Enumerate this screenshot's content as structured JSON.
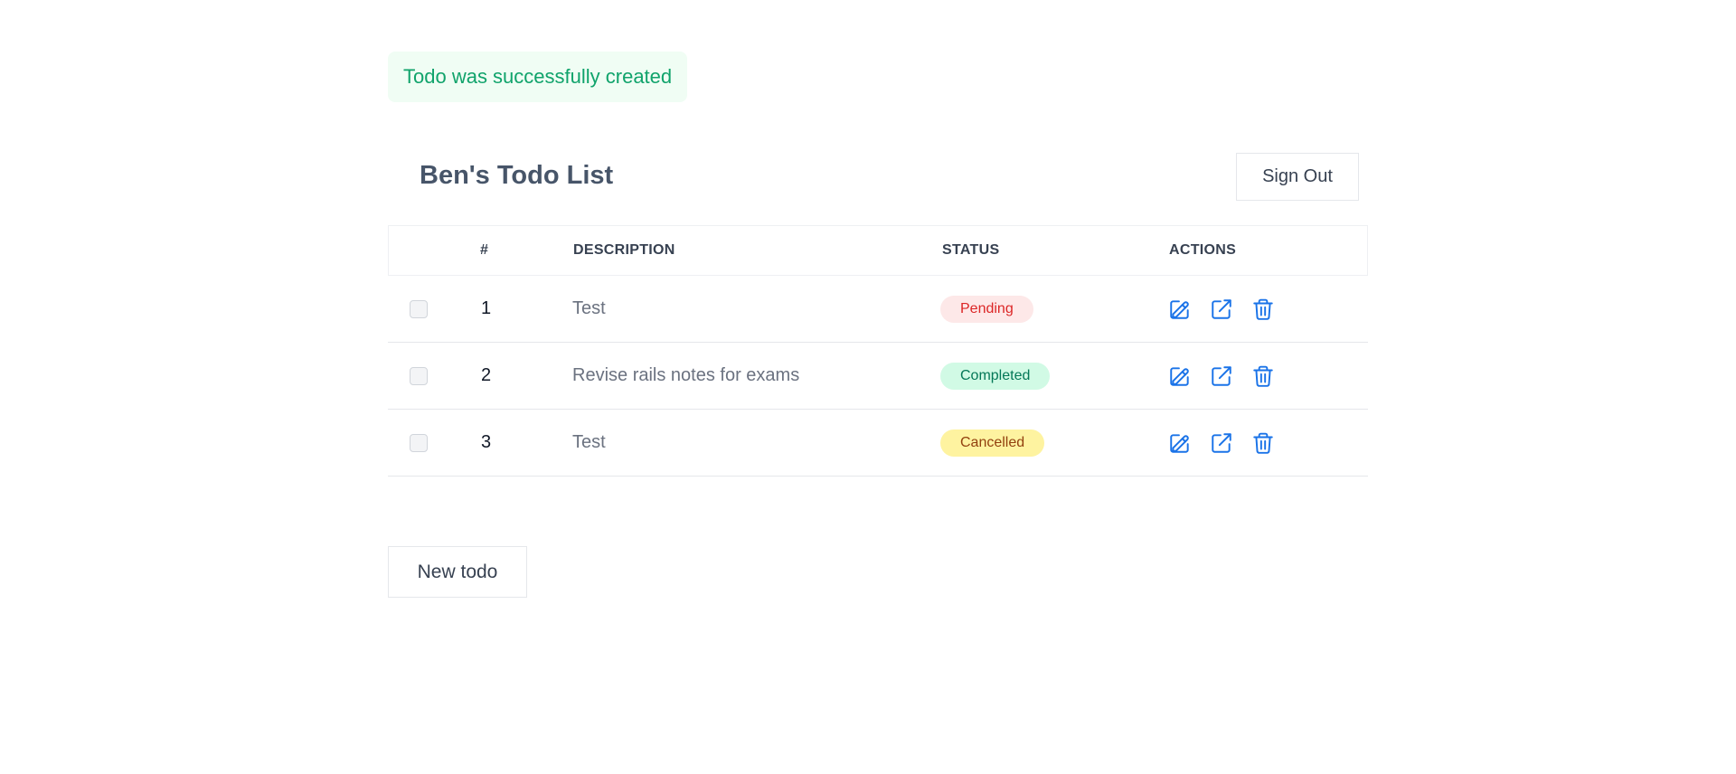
{
  "notice": {
    "message": "Todo was successfully created",
    "color": "#10a36b",
    "background": "#f0fdf4"
  },
  "header": {
    "title": "Ben's Todo List",
    "sign_out_label": "Sign Out"
  },
  "table": {
    "columns": {
      "number": "#",
      "description": "DESCRIPTION",
      "status": "STATUS",
      "actions": "ACTIONS"
    },
    "rows": [
      {
        "number": "1",
        "description": "Test",
        "status": "Pending",
        "status_kind": "pending",
        "checked": false
      },
      {
        "number": "2",
        "description": "Revise rails notes for exams",
        "status": "Completed",
        "status_kind": "completed",
        "checked": false
      },
      {
        "number": "3",
        "description": "Test",
        "status": "Cancelled",
        "status_kind": "cancelled",
        "checked": false
      }
    ],
    "action_icons": [
      "edit-icon",
      "external-link-icon",
      "trash-icon"
    ]
  },
  "status_colors": {
    "pending": {
      "background": "#fde8e8",
      "text": "#dc2626"
    },
    "completed": {
      "background": "#d1fae5",
      "text": "#047857"
    },
    "cancelled": {
      "background": "#fef3a0",
      "text": "#92400e"
    }
  },
  "icon_color": "#1a73e8",
  "footer": {
    "new_todo_label": "New todo"
  }
}
